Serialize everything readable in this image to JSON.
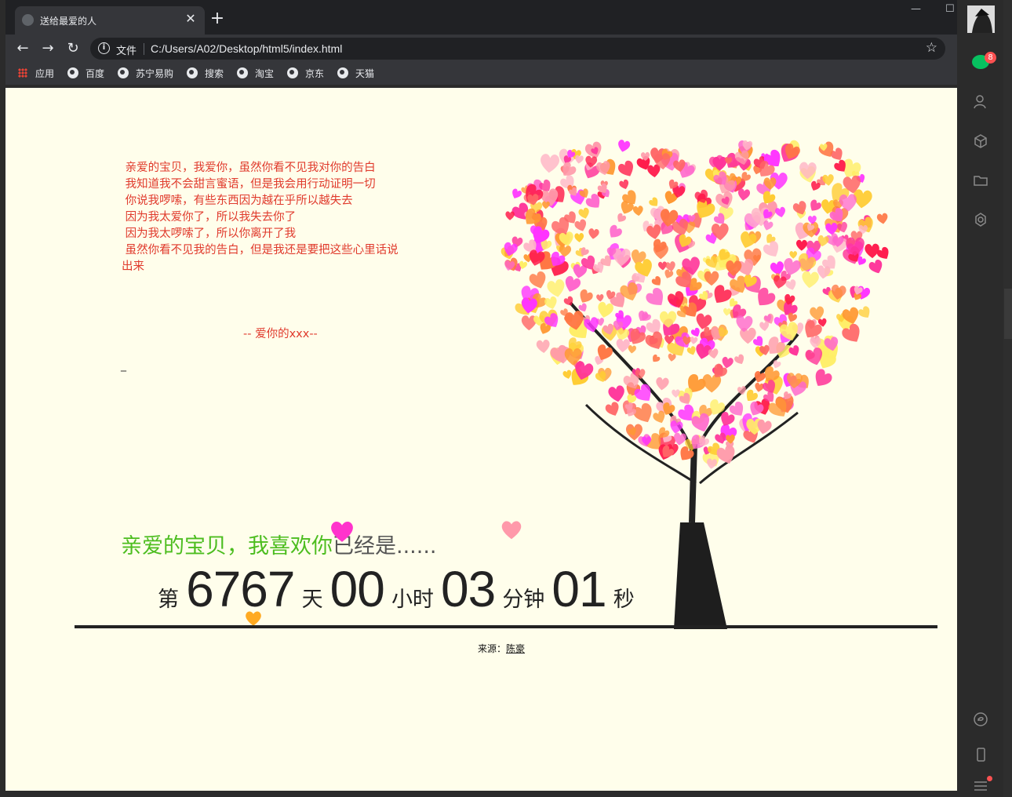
{
  "browser": {
    "tab_title": "送给最爱的人",
    "url_scheme_label": "文件",
    "url": "C:/Users/A02/Desktop/html5/index.html",
    "bookmarks": [
      "应用",
      "百度",
      "苏宁易购",
      "搜索",
      "淘宝",
      "京东",
      "天猫"
    ]
  },
  "letter": {
    "lines": [
      " 亲爱的宝贝，我爱你，虽然你看不见我对你的告白",
      "",
      " 我知道我不会甜言蜜语，但是我会用行动证明一切",
      "",
      " 你说我啰嗦，有些东西因为越在乎所以越失去",
      " 因为我太爱你了，所以我失去你了",
      " 因为我太啰嗦了，所以你离开了我",
      " 虽然你看不见我的告白，但是我还是要把这些心里话说",
      "出来"
    ],
    "signature": "-- 爱你的xxx--",
    "cursor": "_"
  },
  "heading": {
    "green": "亲爱的宝贝，我喜欢你",
    "grey": "已经是......"
  },
  "counter": {
    "prefix": "第",
    "days": "6767",
    "days_unit": "天",
    "hours": "00",
    "hours_unit": "小时",
    "minutes": "03",
    "minutes_unit": "分钟",
    "seconds": "01",
    "seconds_unit": "秒"
  },
  "source": {
    "label": "来源：",
    "link": "陈豪"
  },
  "sidebar": {
    "chat_badge": "8"
  },
  "colors": {
    "page_bg": "#fffeeb",
    "letter_text": "#e03a2c",
    "heading_green": "#4cbd1f",
    "heart_palette": [
      "#ff1a4a",
      "#ff3399",
      "#ff66cc",
      "#ff9933",
      "#ffcc33",
      "#ffee66",
      "#ff6666",
      "#ff99aa",
      "#ff33ff",
      "#ff7744",
      "#ffb3c6"
    ]
  }
}
